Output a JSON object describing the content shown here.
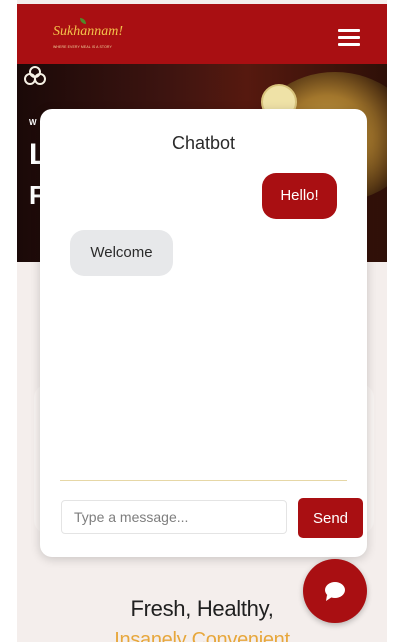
{
  "header": {
    "brand": "Sukhannam!",
    "tagline": "WHERE EVERY MEAL IS A STORY"
  },
  "hero": {
    "line1_fragment": "W",
    "line2_fragment": "L",
    "line3_fragment": "F"
  },
  "chatbot": {
    "title": "Chatbot",
    "messages": [
      {
        "sender": "user",
        "text": "Hello!"
      },
      {
        "sender": "bot",
        "text": "Welcome"
      }
    ],
    "input_placeholder": "Type a message...",
    "send_label": "Send"
  },
  "section": {
    "title": "Fresh, Healthy,",
    "subtitle": "Insanely Convenient"
  },
  "colors": {
    "brand_red": "#a90f12",
    "accent_gold": "#e7a73c",
    "bot_bubble": "#e7e8ea"
  },
  "icons": {
    "menu": "hamburger-menu-icon",
    "chat_toggle": "chat-bubble-icon",
    "hero_badge": "flower-icon"
  }
}
